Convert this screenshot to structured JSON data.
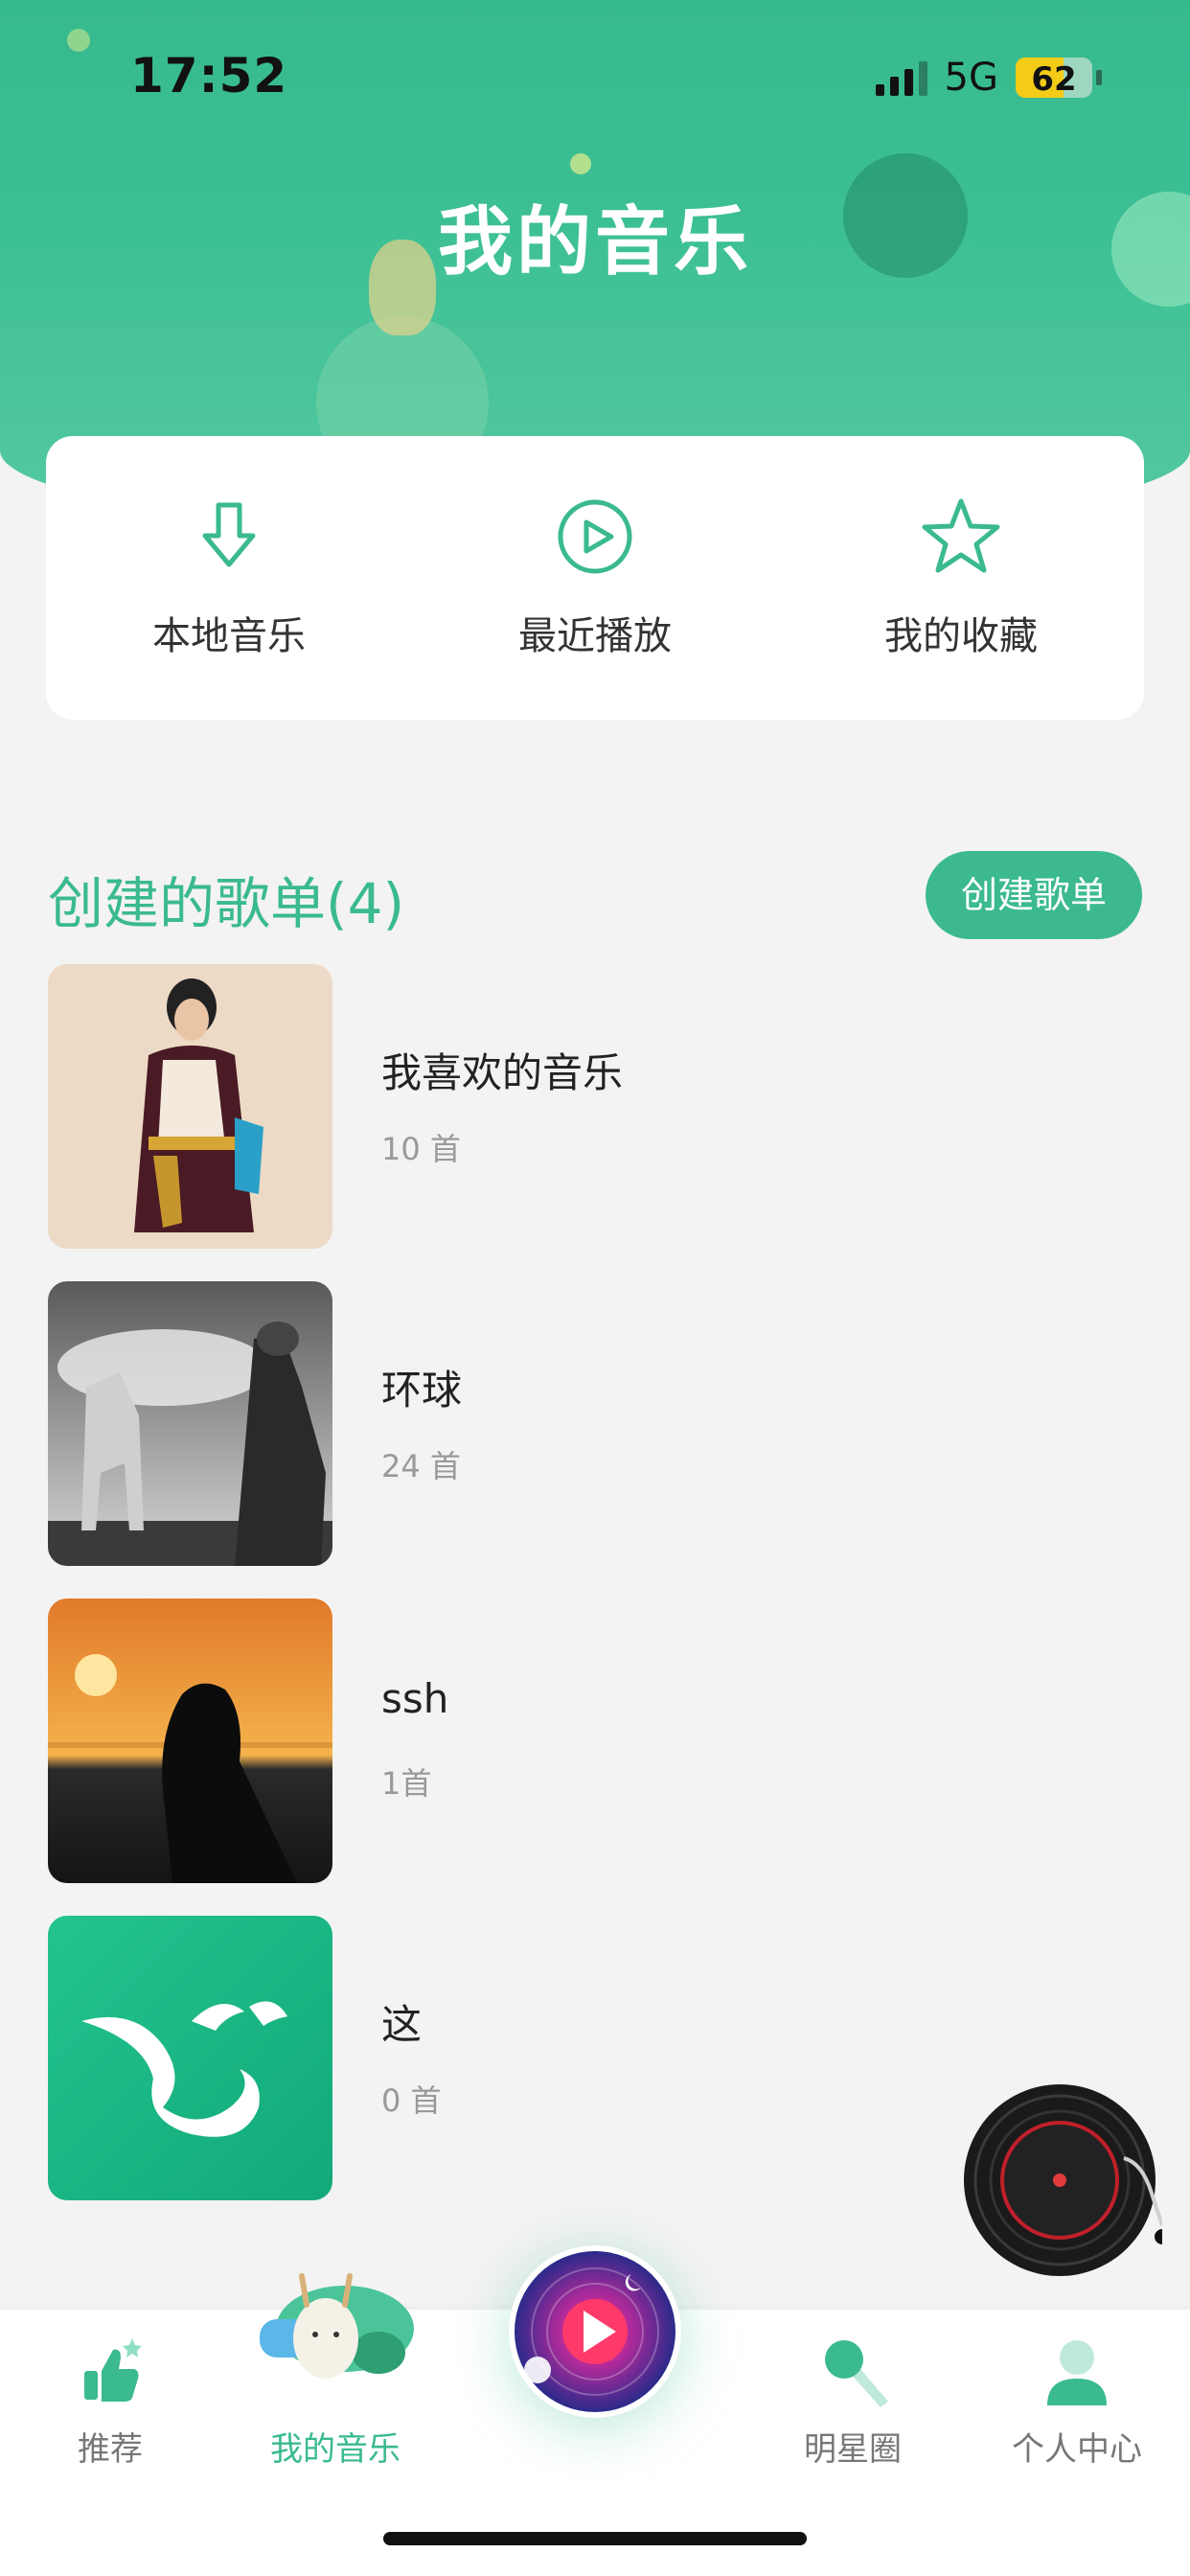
{
  "status_bar": {
    "time": "17:52",
    "network": "5G",
    "battery": "62"
  },
  "header": {
    "title": "我的音乐"
  },
  "quick_actions": [
    {
      "label": "本地音乐",
      "icon": "download-arrow-icon"
    },
    {
      "label": "最近播放",
      "icon": "play-circle-icon"
    },
    {
      "label": "我的收藏",
      "icon": "star-icon"
    }
  ],
  "section": {
    "title": "创建的歌单(4)",
    "create_button": "创建歌单"
  },
  "playlists": [
    {
      "name": "我喜欢的音乐",
      "count": "10 首"
    },
    {
      "name": "环球",
      "count": "24 首"
    },
    {
      "name": "ssh",
      "count": "1首"
    },
    {
      "name": "这",
      "count": "0 首"
    }
  ],
  "tabs": [
    {
      "label": "推荐"
    },
    {
      "label": "我的音乐"
    },
    {
      "label": "明星圈"
    },
    {
      "label": "个人中心"
    }
  ],
  "colors": {
    "accent": "#3aba8e",
    "header": "#3cbf94"
  }
}
